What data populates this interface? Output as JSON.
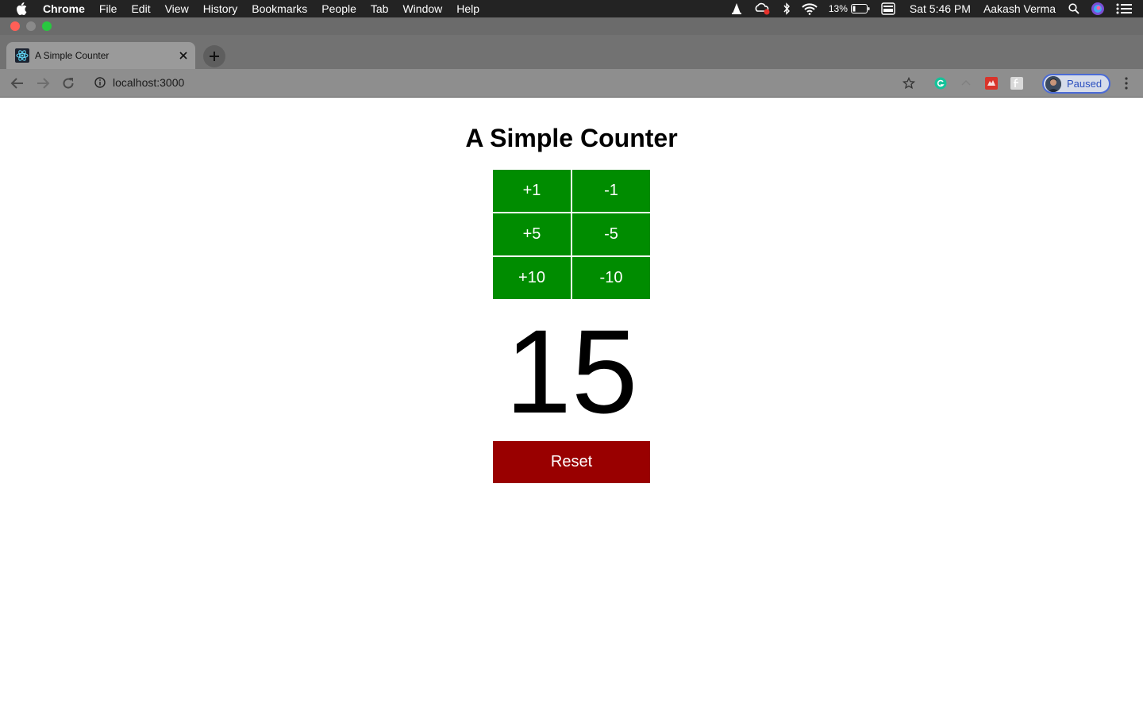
{
  "menubar": {
    "app_name": "Chrome",
    "items": [
      "File",
      "Edit",
      "View",
      "History",
      "Bookmarks",
      "People",
      "Tab",
      "Window",
      "Help"
    ],
    "battery": "13%",
    "clock": "Sat 5:46 PM",
    "user": "Aakash Verma"
  },
  "browser": {
    "tab_title": "A Simple Counter",
    "url": "localhost:3000",
    "profile_status": "Paused"
  },
  "app": {
    "title": "A Simple Counter",
    "buttons": [
      "+1",
      "-1",
      "+5",
      "-5",
      "+10",
      "-10"
    ],
    "count": "15",
    "reset_label": "Reset",
    "colors": {
      "increment_bg": "#008c00",
      "reset_bg": "#990000"
    }
  }
}
